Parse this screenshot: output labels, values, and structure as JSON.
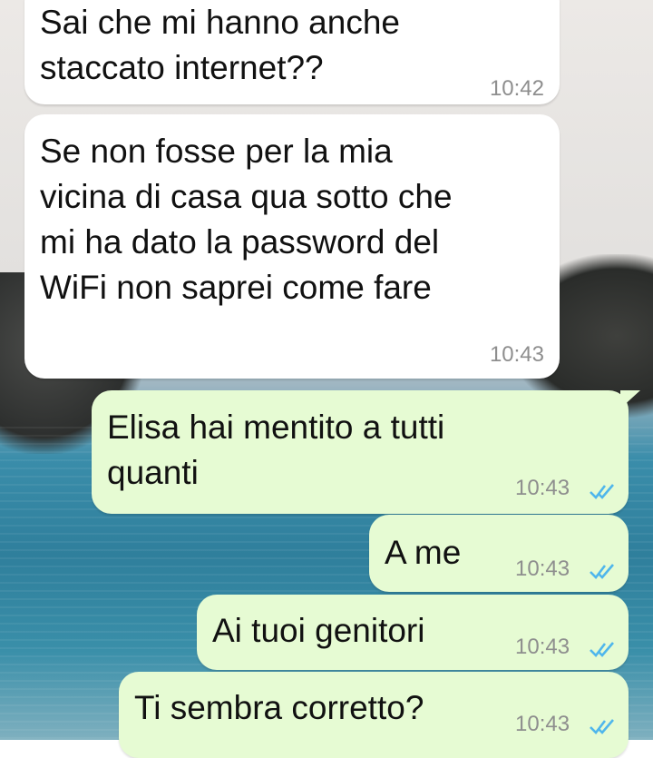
{
  "messages": [
    {
      "text": "Sai che mi hanno anche\nstaccato internet??",
      "time": "10:42",
      "direction": "incoming"
    },
    {
      "text": "Se non fosse per la mia\nvicina di casa qua sotto che\nmi ha dato la password del\nWiFi non saprei come fare",
      "time": "10:43",
      "direction": "incoming"
    },
    {
      "text": "Elisa hai mentito a tutti\nquanti",
      "time": "10:43",
      "direction": "outgoing",
      "status": "read"
    },
    {
      "text": "A me",
      "time": "10:43",
      "direction": "outgoing",
      "status": "read"
    },
    {
      "text": "Ai tuoi genitori",
      "time": "10:43",
      "direction": "outgoing",
      "status": "read"
    },
    {
      "text": "Ti sembra corretto?",
      "time": "10:43",
      "direction": "outgoing",
      "status": "read"
    }
  ],
  "colors": {
    "incoming_bubble": "#ffffff",
    "outgoing_bubble": "#e6fbd3",
    "read_ticks": "#4fb6ec",
    "timestamp": "#8e8e8e"
  },
  "icons": {
    "read_receipt": "double-check-icon"
  }
}
